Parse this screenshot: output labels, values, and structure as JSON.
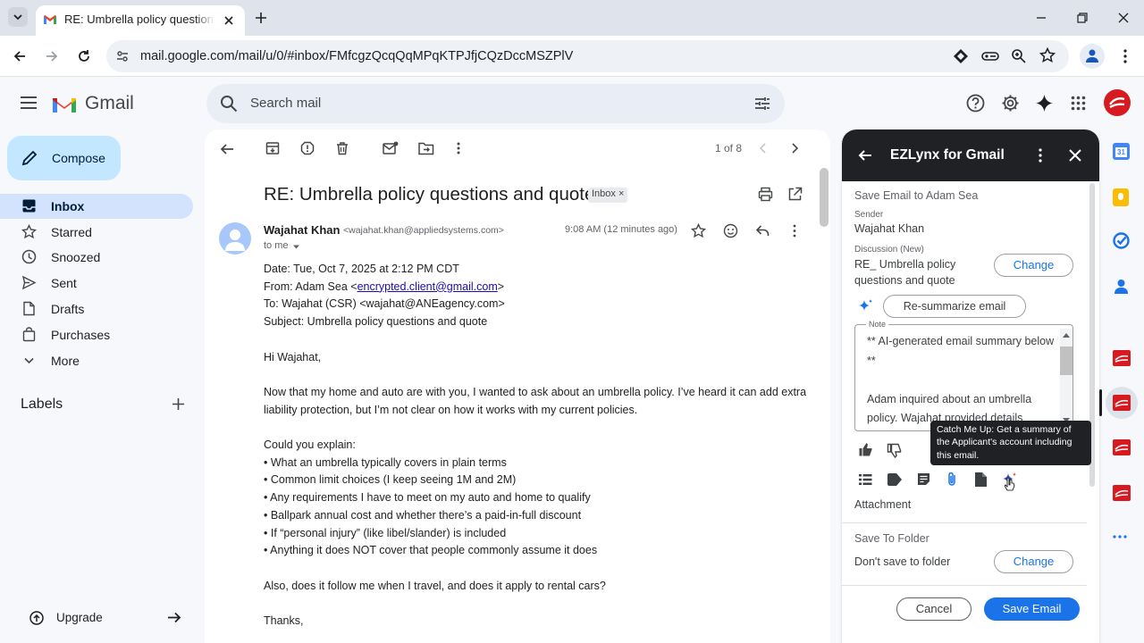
{
  "browser": {
    "tab_title": "RE: Umbrella policy questions a",
    "url": "mail.google.com/mail/u/0/#inbox/FMfcgzQcqQqMPqKTPJfjCQzDccMSZPlV"
  },
  "gmail": {
    "logo_text": "Gmail",
    "search_placeholder": "Search mail",
    "compose_label": "Compose",
    "nav": [
      {
        "label": "Inbox",
        "icon": "inbox-icon"
      },
      {
        "label": "Starred",
        "icon": "star-icon"
      },
      {
        "label": "Snoozed",
        "icon": "clock-icon"
      },
      {
        "label": "Sent",
        "icon": "send-icon"
      },
      {
        "label": "Drafts",
        "icon": "draft-icon"
      },
      {
        "label": "Purchases",
        "icon": "bag-icon"
      },
      {
        "label": "More",
        "icon": "chevron-down-icon"
      }
    ],
    "labels_heading": "Labels",
    "upgrade_label": "Upgrade",
    "pagination": "1 of 8"
  },
  "email": {
    "subject": "RE: Umbrella policy questions and quote",
    "inbox_chip": "Inbox",
    "sender_name": "Wajahat Khan",
    "sender_email": "<wajahat.khan@appliedsystems.com>",
    "time": "9:08 AM (12 minutes ago)",
    "to_me": "to me",
    "header_date": "Date: Tue, Oct 7, 2025 at 2:12 PM CDT",
    "header_from_prefix": "From: Adam Sea <",
    "header_from_email": "encrypted.client@gmail.com",
    "header_from_suffix": ">",
    "header_to": "To: Wajahat (CSR) <wajahat@ANEagency.com>",
    "header_subject": "Subject: Umbrella policy questions and quote",
    "greeting": "Hi Wajahat,",
    "para1_line1": "Now that my home and auto are with you, I wanted to ask about an umbrella policy. I’ve heard it can add extra",
    "para1_line2": "liability protection, but I’m not clear on how it works with my current policies.",
    "could_you": "Could you explain:",
    "bullets": [
      "• What an umbrella typically covers in plain terms",
      "• Common limit choices (I keep seeing 1M and 2M)",
      "• Any requirements I have to meet on my auto and home to qualify",
      "• Ballpark annual cost and whether there’s a paid-in-full discount",
      "• If “personal injury” (like libel/slander) is included",
      "• Anything it does NOT cover that people commonly assume it does"
    ],
    "para2": "Also, does it follow me when I travel, and does it apply to rental cars?",
    "thanks": "Thanks,"
  },
  "ezlynx": {
    "title": "EZLynx for Gmail",
    "save_to": "Save Email to Adam Sea",
    "sender_label": "Sender",
    "sender_value": "Wajahat Khan",
    "discussion_label": "Discussion (New)",
    "discussion_line1": "RE_ Umbrella policy",
    "discussion_line2": "questions and quote",
    "change_label": "Change",
    "resummarize_label": "Re-summarize email",
    "note_label": "Note",
    "note_text": "** AI-generated email summary below **\n\nAdam inquired about an umbrella policy. Wajahat provided details",
    "tooltip": "Catch Me Up: Get a summary of the Applicant's account including this email.",
    "attachment_label": "Attachment",
    "folder_heading": "Save To Folder",
    "folder_value": "Don't save to folder",
    "cancel_label": "Cancel",
    "save_email_label": "Save Email"
  },
  "colors": {
    "accent": "#1a73e8",
    "compose_bg": "#c2e7ff",
    "nav_active": "#d3e3fd",
    "ez_header": "#202124"
  }
}
